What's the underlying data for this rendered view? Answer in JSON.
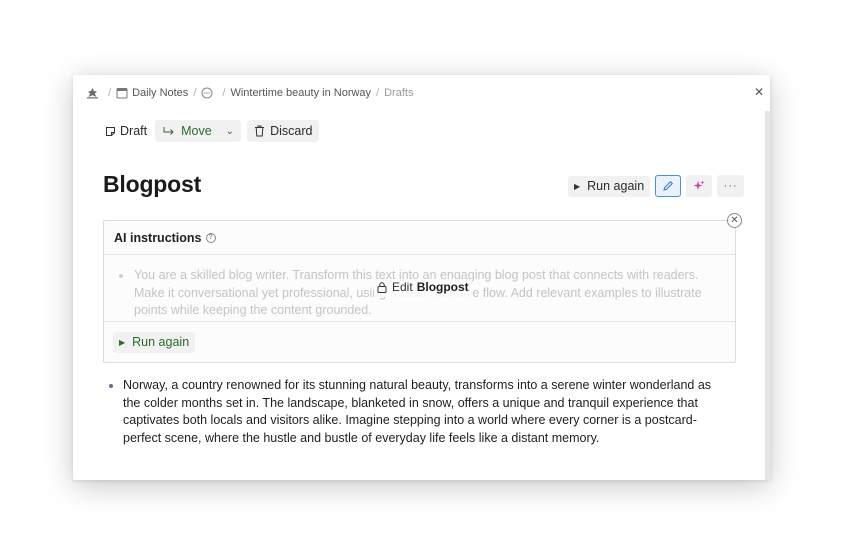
{
  "breadcrumb": {
    "daily_notes": "Daily Notes",
    "page": "Wintertime beauty in Norway",
    "current": "Drafts"
  },
  "toolbar": {
    "draft_label": "Draft",
    "move_label": "Move",
    "discard_label": "Discard"
  },
  "title": "Blogpost",
  "actions": {
    "run_again_label": "Run again"
  },
  "ai_instructions": {
    "heading": "AI instructions",
    "help_glyph": "?",
    "text": "You are a skilled blog writer. Transform this text into an engaging blog post that connects with readers. Make it conversational yet professional, using a clear narrative flow. Add relevant examples to illustrate points while keeping the content grounded.",
    "edit_label": "Edit",
    "edit_target": "Blogpost",
    "run_again_label": "Run again"
  },
  "body": {
    "paragraph": "Norway, a country renowned for its stunning natural beauty, transforms into a serene winter wonderland as the colder months set in. The landscape, blanketed in snow, offers a unique and tranquil experience that captivates both locals and visitors alike. Imagine stepping into a world where every corner is a postcard-perfect scene, where the hustle and bustle of everyday life feels like a distant memory."
  },
  "colors": {
    "accent_green": "#2d6a2d",
    "active_blue": "#4a8fe0",
    "sparkle_pink": "#d63aa6"
  }
}
